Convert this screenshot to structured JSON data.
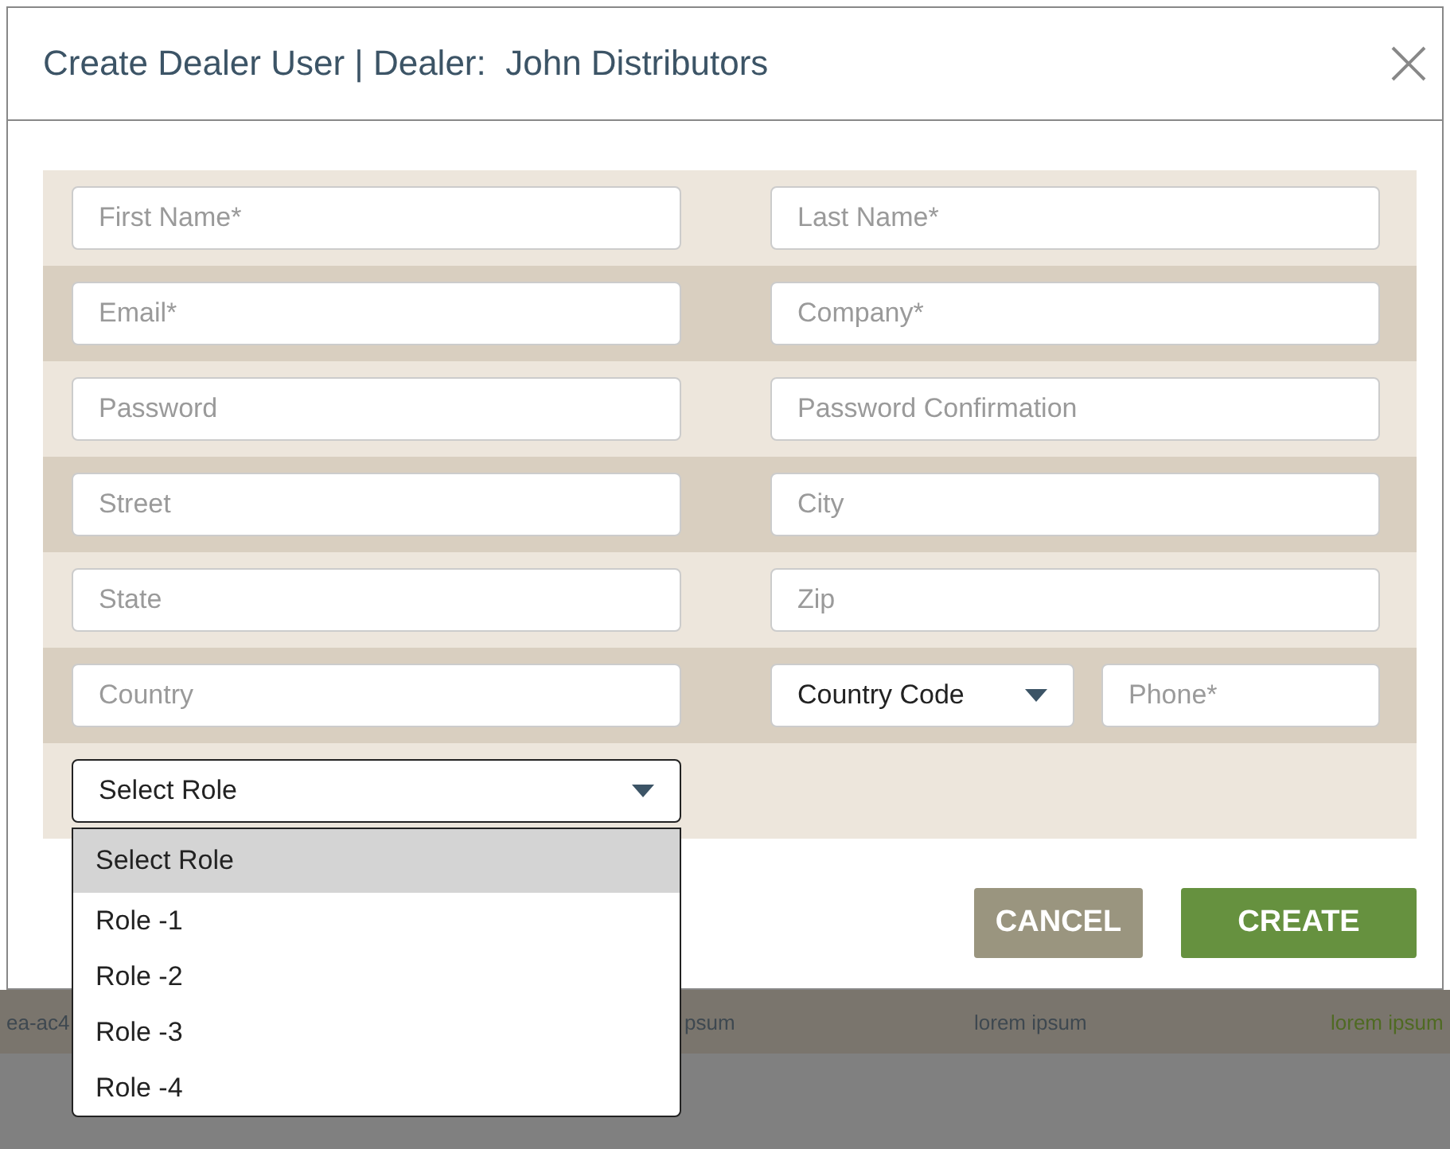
{
  "dialog": {
    "title": "Create Dealer User | Dealer:  John Distributors"
  },
  "form": {
    "rows": [
      {
        "fields": [
          {
            "kind": "input",
            "placeholder": "First Name*"
          },
          {
            "kind": "input",
            "placeholder": "Last Name*"
          }
        ]
      },
      {
        "fields": [
          {
            "kind": "input",
            "placeholder": "Email*"
          },
          {
            "kind": "input",
            "placeholder": "Company*"
          }
        ]
      },
      {
        "fields": [
          {
            "kind": "input",
            "placeholder": "Password"
          },
          {
            "kind": "input",
            "placeholder": "Password Confirmation"
          }
        ]
      },
      {
        "fields": [
          {
            "kind": "input",
            "placeholder": "Street"
          },
          {
            "kind": "input",
            "placeholder": "City"
          }
        ]
      },
      {
        "fields": [
          {
            "kind": "input",
            "placeholder": "State"
          },
          {
            "kind": "input",
            "placeholder": "Zip"
          }
        ]
      },
      {
        "fields": [
          {
            "kind": "input",
            "placeholder": "Country"
          },
          {
            "kind": "phone",
            "code": {
              "value": "Country Code"
            },
            "placeholder": "Phone*"
          }
        ]
      },
      {
        "fields": [
          {
            "kind": "select",
            "value": "Select Role",
            "expanded": true,
            "options": [
              {
                "label": "Select Role",
                "selected": true
              },
              {
                "label": "Role -1",
                "selected": false
              },
              {
                "label": "Role -2",
                "selected": false
              },
              {
                "label": "Role -3",
                "selected": false
              },
              {
                "label": "Role -4",
                "selected": false
              }
            ]
          }
        ]
      }
    ]
  },
  "buttons": [
    {
      "label": "CANCEL",
      "kind": "secondary"
    },
    {
      "label": "CREATE",
      "kind": "primary"
    }
  ],
  "background_row": [
    {
      "text": "ea-ac4",
      "color": "#3e4850"
    },
    {
      "text": "psum",
      "color": "#3e4850"
    },
    {
      "text": "lorem ipsum",
      "color": "#3e4850"
    },
    {
      "text": "lorem ipsum",
      "color": "#4f6a22"
    }
  ]
}
